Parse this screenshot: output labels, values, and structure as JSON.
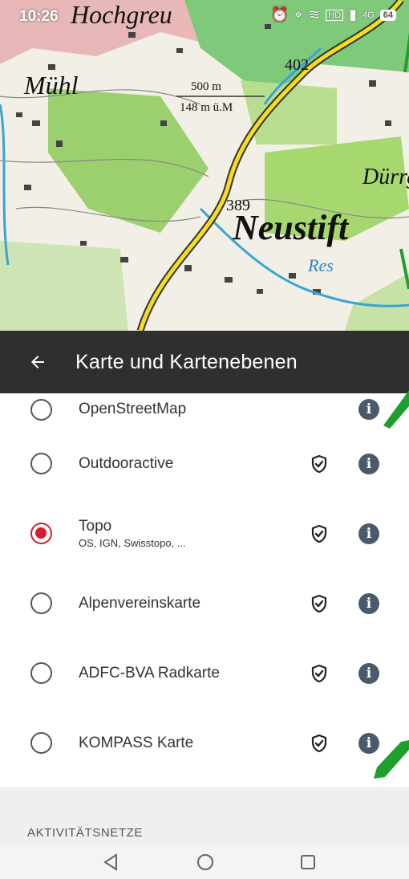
{
  "status": {
    "time": "10:26",
    "battery": "64",
    "network": "4G"
  },
  "map": {
    "labels": {
      "town1": "Hochgreu",
      "town2": "Mühl",
      "town3": "Neustift",
      "town4": "Dürrg",
      "town5": "Res",
      "road": "402",
      "peak": "389"
    },
    "scale": {
      "big": "500 m",
      "small": "148 m ü.M"
    }
  },
  "appbar": {
    "title": "Karte und Kartenebenen"
  },
  "layers": [
    {
      "label": "OpenStreetMap",
      "sub": "",
      "selected": false,
      "premium": false
    },
    {
      "label": "Outdooractive",
      "sub": "",
      "selected": false,
      "premium": true
    },
    {
      "label": "Topo",
      "sub": "OS, IGN, Swisstopo, ...",
      "selected": true,
      "premium": true
    },
    {
      "label": "Alpenvereinskarte",
      "sub": "",
      "selected": false,
      "premium": true
    },
    {
      "label": "ADFC-BVA Radkarte",
      "sub": "",
      "selected": false,
      "premium": true
    },
    {
      "label": "KOMPASS Karte",
      "sub": "",
      "selected": false,
      "premium": true
    }
  ],
  "section": {
    "title": "AKTIVITÄTSNETZE"
  },
  "colors": {
    "accent": "#d41e2c",
    "appbar": "#2f2f2f",
    "info": "#4b5a6b",
    "annotation": "#1f9e2c"
  },
  "icons": {
    "back": "arrow-left-icon",
    "info": "info-icon",
    "premium": "shield-check-icon"
  }
}
